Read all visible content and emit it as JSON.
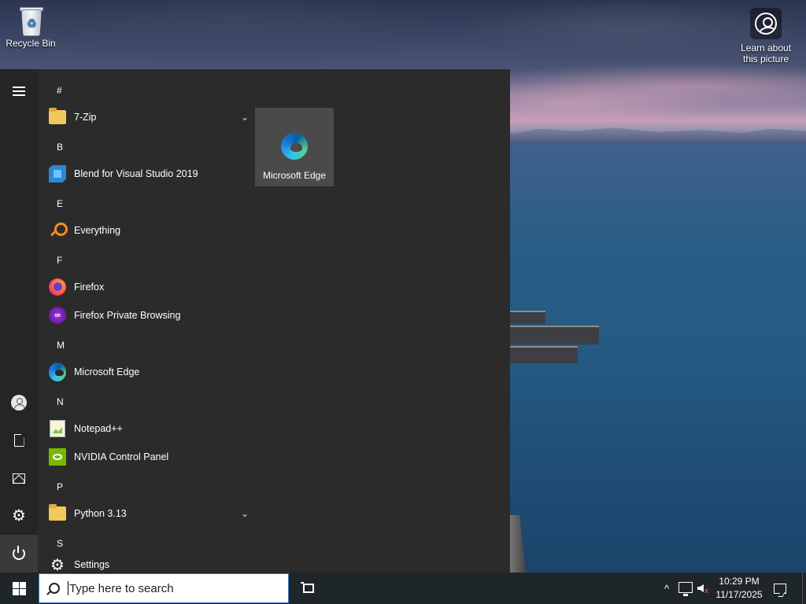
{
  "desktop": {
    "icons": [
      {
        "label": "Recycle Bin",
        "icon": "recycle-bin-icon"
      },
      {
        "label": "Learn about\nthis picture",
        "icon": "learn-picture-icon"
      }
    ]
  },
  "start_menu": {
    "rail": [
      {
        "name": "expand",
        "icon": "hamburger-menu-icon"
      },
      {
        "name": "account",
        "icon": "user-icon"
      },
      {
        "name": "documents",
        "icon": "document-icon"
      },
      {
        "name": "pictures",
        "icon": "pictures-icon"
      },
      {
        "name": "settings",
        "icon": "gear-icon"
      },
      {
        "name": "power",
        "icon": "power-icon"
      }
    ],
    "sections": [
      {
        "letter": "#",
        "apps": [
          {
            "label": "7-Zip",
            "icon": "folder-icon",
            "expandable": true
          }
        ]
      },
      {
        "letter": "B",
        "apps": [
          {
            "label": "Blend for Visual Studio 2019",
            "icon": "blend-icon"
          }
        ]
      },
      {
        "letter": "E",
        "apps": [
          {
            "label": "Everything",
            "icon": "everything-search-icon"
          }
        ]
      },
      {
        "letter": "F",
        "apps": [
          {
            "label": "Firefox",
            "icon": "firefox-icon"
          },
          {
            "label": "Firefox Private Browsing",
            "icon": "firefox-private-icon"
          }
        ]
      },
      {
        "letter": "M",
        "apps": [
          {
            "label": "Microsoft Edge",
            "icon": "edge-icon"
          }
        ]
      },
      {
        "letter": "N",
        "apps": [
          {
            "label": "Notepad++",
            "icon": "notepadpp-icon"
          },
          {
            "label": "NVIDIA Control Panel",
            "icon": "nvidia-icon"
          }
        ]
      },
      {
        "letter": "P",
        "apps": [
          {
            "label": "Python 3.13",
            "icon": "folder-icon",
            "expandable": true
          }
        ]
      },
      {
        "letter": "S",
        "apps": [
          {
            "label": "Settings",
            "icon": "gear-icon"
          }
        ]
      }
    ],
    "tiles": [
      {
        "label": "Microsoft Edge",
        "icon": "edge-icon"
      }
    ]
  },
  "taskbar": {
    "search_placeholder": "Type here to search",
    "clock": {
      "time": "10:29 PM",
      "date": "11/17/2025"
    },
    "tray": {
      "overflow_glyph": "^",
      "muted_glyph": "x"
    }
  },
  "colors": {
    "start_bg": "#2b2b2b",
    "taskbar_bg": "#1f2629",
    "tile_bg": "#4a4a4a",
    "search_border": "#3a78c4"
  }
}
